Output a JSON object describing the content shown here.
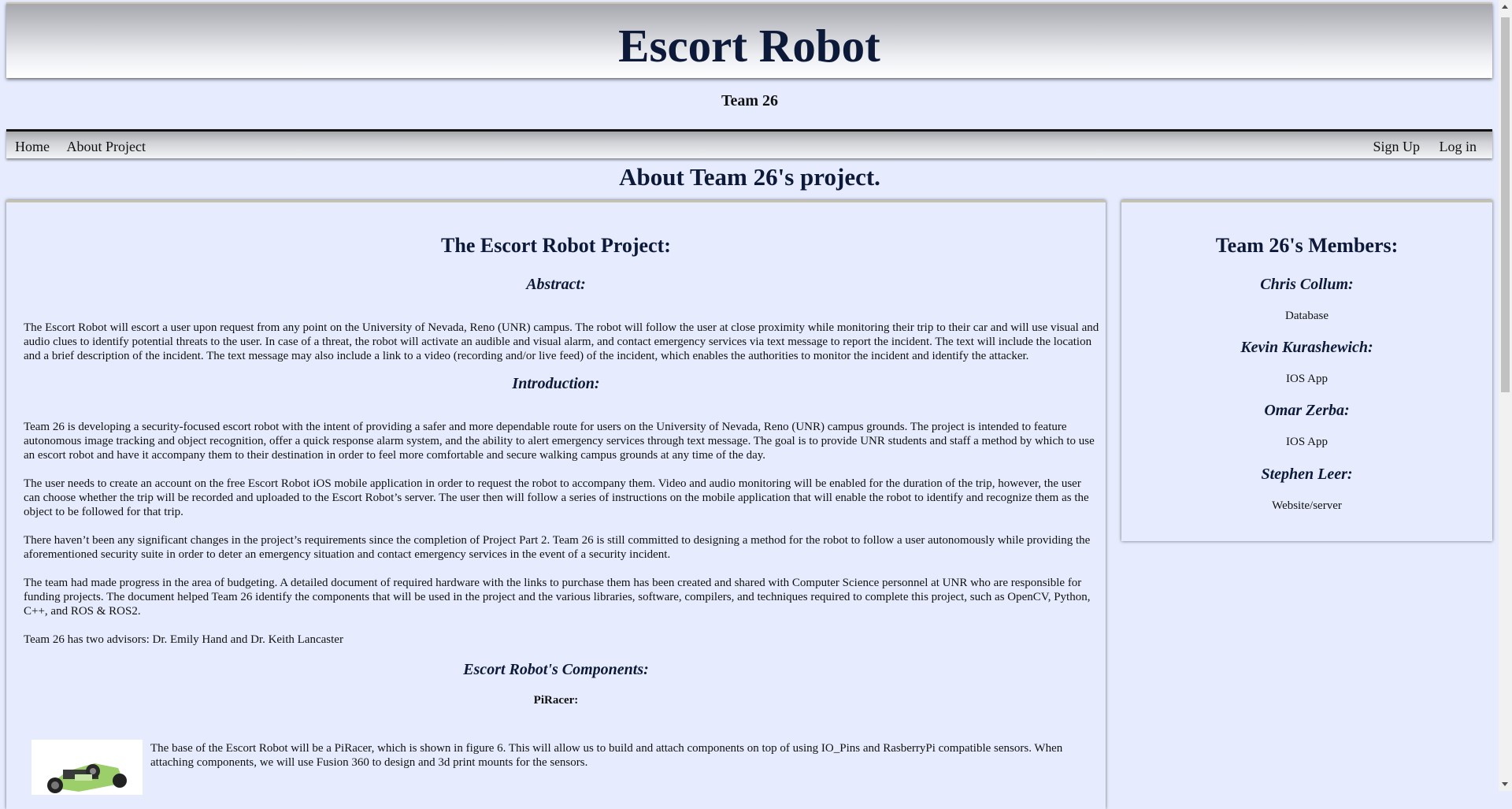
{
  "header": {
    "title": "Escort Robot",
    "subtitle": "Team 26"
  },
  "nav": {
    "left": [
      "Home",
      "About Project"
    ],
    "right": [
      "Sign Up",
      "Log in"
    ]
  },
  "page_title": "About Team 26's project.",
  "main": {
    "heading": "The Escort Robot Project:",
    "abstract_heading": "Abstract:",
    "abstract": "The Escort Robot will escort a user upon request from any point on the University of Nevada, Reno (UNR) campus. The robot will follow the user at close proximity while monitoring their trip to their car and will use visual and audio clues to identify potential threats to the user. In case of a threat, the robot will activate an audible and visual alarm, and contact emergency services via text message to report the incident. The text will include the location and a brief description of the incident. The text message may also include a link to a video (recording and/or live feed) of the incident, which enables the authorities to monitor the incident and identify the attacker.",
    "intro_heading": "Introduction:",
    "intro_p1": "Team 26 is developing a security-focused escort robot with the intent of providing a safer and more dependable route for users on the University of Nevada, Reno (UNR) campus grounds. The project is intended to feature autonomous image tracking and object recognition, offer a quick response alarm system, and the ability to alert emergency services through text message. The goal is to provide UNR students and staff a method by which to use an escort robot and have it accompany them to their destination in order to feel more comfortable and secure walking campus grounds at any time of the day.",
    "intro_p2": "The user needs to create an account on the free Escort Robot iOS mobile application in order to request the robot to accompany them. Video and audio monitoring will be enabled for the duration of the trip, however, the user can choose whether the trip will be recorded and uploaded to the Escort Robot’s server. The user then will follow a series of instructions on the mobile application that will enable the robot to identify and recognize them as the object to be followed for that trip.",
    "intro_p3": "There haven’t been any significant changes in the project’s requirements since the completion of Project Part 2. Team 26 is still committed to designing a method for the robot to follow a user autonomously while providing the aforementioned security suite in order to deter an emergency situation and contact emergency services in the event of a security incident.",
    "intro_p4": "The team had made progress in the area of budgeting. A detailed document of required hardware with the links to purchase them has been created and shared with Computer Science personnel at UNR who are responsible for funding projects. The document helped Team 26 identify the components that will be used in the project and the various libraries, software, compilers, and techniques required to complete this project, such as OpenCV, Python, C++, and ROS & ROS2.",
    "intro_p5": "Team 26 has two advisors: Dr. Emily Hand and Dr. Keith Lancaster",
    "components_heading": "Escort Robot's Components:",
    "piracer_heading": "PiRacer:",
    "piracer_text": "The base of the Escort Robot will be a PiRacer, which is shown in figure 6. This will allow us to build and attach components on top of using IO_Pins and RasberryPi compatible sensors. When attaching components, we will use Fusion 360 to design and 3d print mounts for the sensors."
  },
  "members": {
    "heading": "Team 26's Members:",
    "list": [
      {
        "name": "Chris Collum:",
        "role": "Database"
      },
      {
        "name": "Kevin Kurashewich:",
        "role": "IOS App"
      },
      {
        "name": "Omar Zerba:",
        "role": "IOS App"
      },
      {
        "name": "Stephen Leer:",
        "role": "Website/server"
      }
    ]
  }
}
